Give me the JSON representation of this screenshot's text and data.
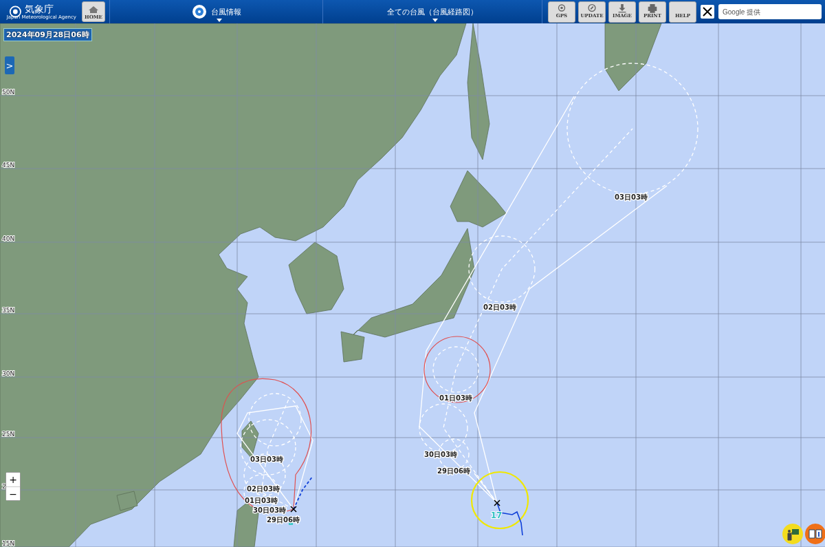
{
  "header": {
    "logo": {
      "title": "気象庁",
      "subtitle": "Japan Meteorological Agency"
    },
    "home_button": "HOME",
    "menus": [
      {
        "label": "台風情報"
      },
      {
        "label": "全ての台風（台風経路図）"
      }
    ],
    "tools": [
      {
        "kind": "gps",
        "label": "GPS"
      },
      {
        "kind": "update",
        "label": "UPDATE"
      },
      {
        "kind": "image",
        "label": "IMAGE"
      },
      {
        "kind": "print",
        "label": "PRINT"
      },
      {
        "kind": "help",
        "label": "HELP"
      }
    ],
    "search": {
      "placeholder": "Google 提供"
    }
  },
  "map": {
    "datetime": "2024年09月28日06時",
    "panel_toggle": ">",
    "latitude_labels": [
      "50N",
      "45N",
      "40N",
      "35N",
      "30N",
      "25N",
      "2",
      "15N"
    ],
    "zoom": [
      "+",
      "−"
    ],
    "typhoons": [
      {
        "times": [
          "03日03時",
          "02日03時",
          "01日03時",
          "30日03時",
          "29日06時"
        ]
      },
      {
        "number": "17",
        "times": [
          "03日03時",
          "02日03時",
          "01日03時",
          "30日03時",
          "29日06時"
        ]
      }
    ]
  }
}
